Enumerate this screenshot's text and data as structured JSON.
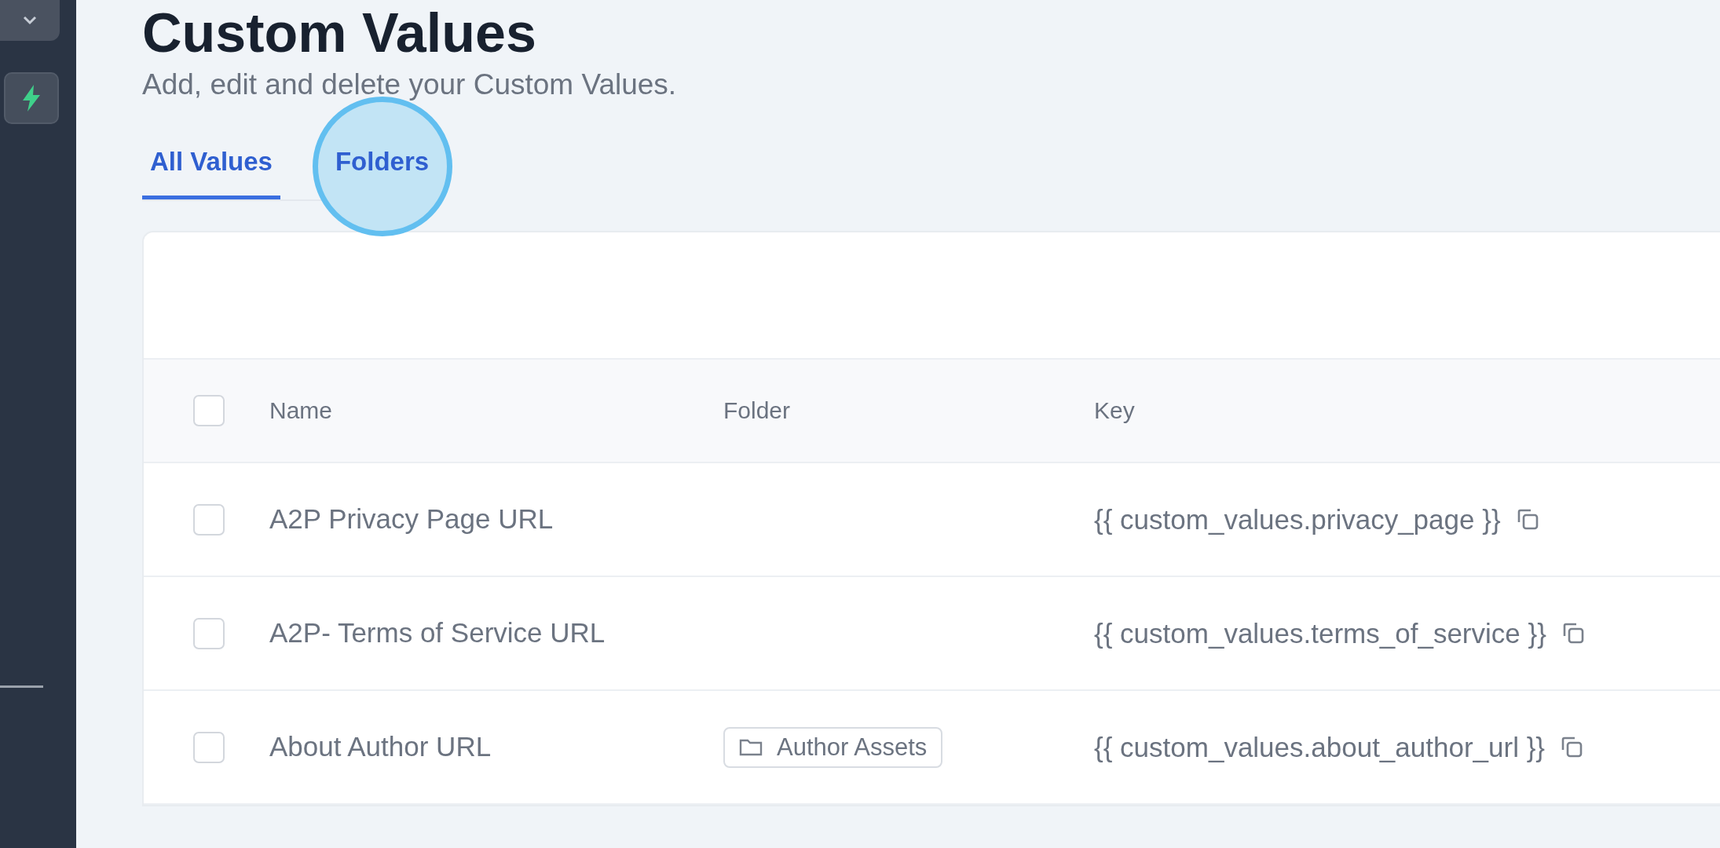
{
  "page": {
    "title": "Custom Values",
    "subtitle": "Add, edit and delete your Custom Values."
  },
  "tabs": [
    {
      "label": "All Values",
      "selected": true
    },
    {
      "label": "Folders",
      "selected": false,
      "hovered": true
    }
  ],
  "table": {
    "header_checked": false,
    "columns": [
      "Name",
      "Folder",
      "Key"
    ],
    "rows": [
      {
        "checked": false,
        "name": "A2P Privacy Page URL",
        "key": "{{ custom_values.privacy_page }}"
      },
      {
        "checked": false,
        "name": "A2P- Terms of Service URL",
        "key": "{{ custom_values.terms_of_service }}"
      },
      {
        "checked": false,
        "name": "About Author URL",
        "folder": "Author Assets",
        "key": "{{ custom_values.about_author_url }}"
      }
    ]
  }
}
